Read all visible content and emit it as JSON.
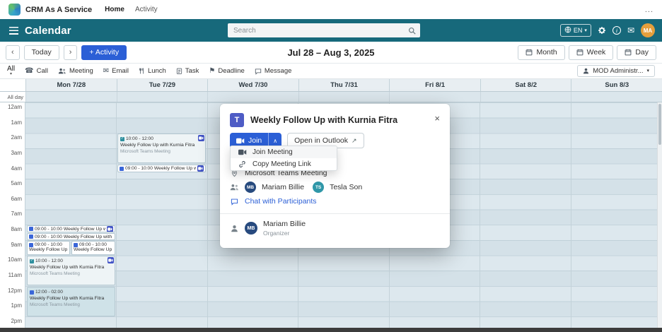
{
  "topbar": {
    "app_title": "CRM As A Service",
    "nav": [
      "Home",
      "Activity"
    ],
    "more": "..."
  },
  "header": {
    "title": "Calendar",
    "search_placeholder": "Search",
    "language": "EN",
    "avatar": "MA"
  },
  "toolbar": {
    "today": "Today",
    "activity": "+ Activity",
    "date_range": "Jul 28 – Aug 3, 2025",
    "views": [
      "Month",
      "Week",
      "Day"
    ]
  },
  "filterbar": {
    "all": "All",
    "items": [
      "Call",
      "Meeting",
      "Email",
      "Lunch",
      "Task",
      "Deadline",
      "Message"
    ],
    "owner": "MOD Administr..."
  },
  "calendar": {
    "allday_label": "All day",
    "days": [
      "Mon 7/28",
      "Tue 7/29",
      "Wed 7/30",
      "Thu 7/31",
      "Fri 8/1",
      "Sat 8/2",
      "Sun 8/3"
    ],
    "times": [
      "12am",
      "1am",
      "2am",
      "3am",
      "4am",
      "5am",
      "6am",
      "7am",
      "8am",
      "9am",
      "10am",
      "11am",
      "12pm",
      "1pm",
      "2pm"
    ],
    "events": [
      {
        "time": "09:00 - 10:00",
        "title": "Weekly Follow Up with Kurn"
      },
      {
        "time": "09:00 - 10:00",
        "title": "Weekly Follow Up with Kurnia Fit"
      },
      {
        "time": "09:00 - 10:00",
        "title": "Weekly Follow Up with"
      },
      {
        "time": "09:00 - 10:00",
        "title": "Weekly Follow Up with"
      },
      {
        "time": "10:00 - 12:00",
        "title": "Weekly Follow Up with Kurnia Fitra",
        "subtitle": "Microsoft Teams Meeting"
      },
      {
        "time": "12:00 - 02:00",
        "title": "Weekly Follow Up with Kurnia Fitra",
        "subtitle": "Microsoft Teams Meeting"
      },
      {
        "time": "10:00 - 12:00",
        "title": "Weekly Follow Up with Kurnia Fitra",
        "subtitle": "Microsoft Teams Meeting"
      },
      {
        "time": "09:00 - 10:00",
        "title": "Weekly Follow Up with Kurn"
      }
    ]
  },
  "modal": {
    "title": "Weekly Follow Up with Kurnia Fitra",
    "join": "Join",
    "open_outlook": "Open in Outlook",
    "menu": [
      "Join Meeting",
      "Copy Meeting Link"
    ],
    "location": "Microsoft Teams Meeting",
    "attendees": [
      {
        "initials": "MB",
        "name": "Mariam Billie"
      },
      {
        "initials": "TS",
        "name": "Tesla Son"
      }
    ],
    "chat": "Chat with Participants",
    "organizer": {
      "initials": "MB",
      "name": "Mariam Billie",
      "role": "Organizer"
    }
  },
  "icons": {
    "envelope": "✉",
    "phone": "☎",
    "flag": "⚑",
    "caret": "▾",
    "caret_up": "∧",
    "chevron_left": "‹",
    "chevron_right": "›",
    "close": "×",
    "check": "✓",
    "external": "↗",
    "info": "i",
    "teams": "T"
  },
  "colors": {
    "header_teal": "#17697b",
    "accent_blue": "#2b5fd6",
    "teams_blue": "#4e5cc5",
    "avatar_orange": "#e59f3c"
  }
}
